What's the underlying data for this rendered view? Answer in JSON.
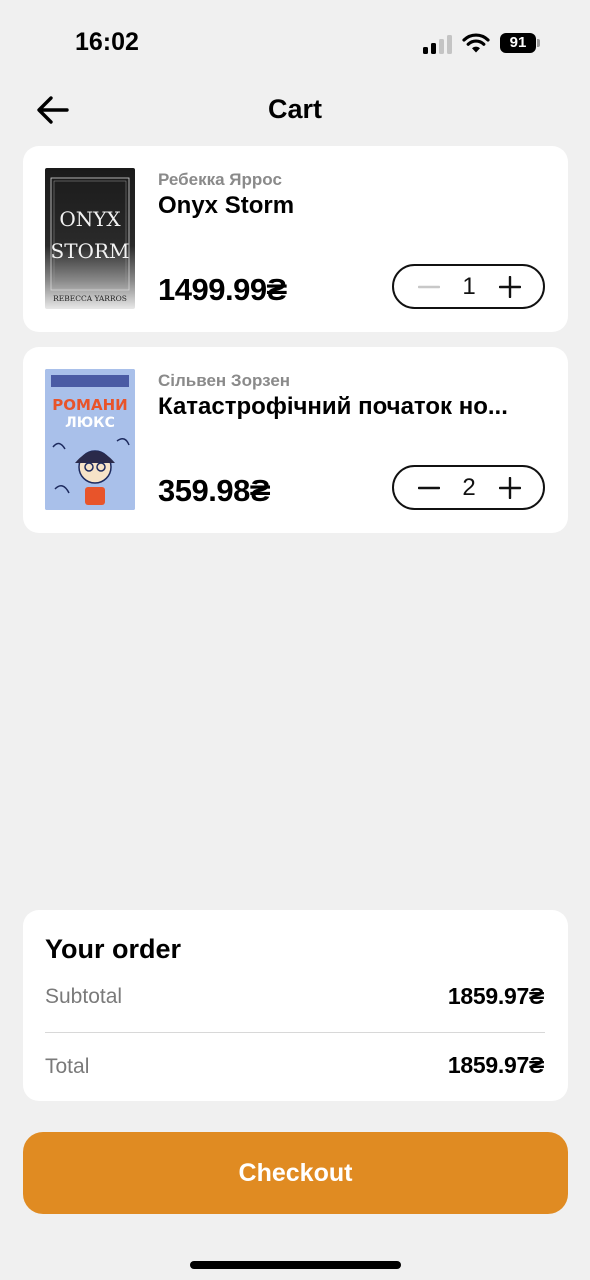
{
  "status_bar": {
    "time": "16:02",
    "battery": "91"
  },
  "header": {
    "title": "Cart"
  },
  "cart": {
    "items": [
      {
        "author": "Ребекка Яррос",
        "title": "Onyx Storm",
        "price": "1499.99₴",
        "quantity": "1",
        "cover": {
          "line1": "ONYX",
          "line2": "STORM",
          "author": "REBECCA YARROS"
        }
      },
      {
        "author": "Сільвен Зорзен",
        "title": "Катастрофічний початок но...",
        "price": "359.98₴",
        "quantity": "2",
        "cover": {
          "line1": "РОМАНИ",
          "line2": "ЛЮКС"
        }
      }
    ]
  },
  "order": {
    "title": "Your order",
    "subtotal_label": "Subtotal",
    "subtotal_value": "1859.97₴",
    "total_label": "Total",
    "total_value": "1859.97₴"
  },
  "checkout": {
    "label": "Checkout"
  },
  "colors": {
    "accent": "#e08b22",
    "background": "#f0f0f0",
    "card": "#ffffff"
  },
  "icons": [
    "back-arrow-icon",
    "minus-icon",
    "plus-icon",
    "signal-icon",
    "wifi-icon",
    "battery-icon"
  ]
}
